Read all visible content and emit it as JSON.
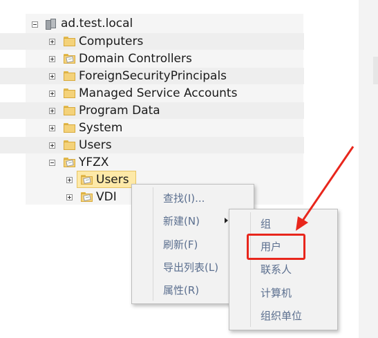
{
  "tree": {
    "root_label": "ad.test.local",
    "items": [
      {
        "label": "Computers",
        "icon": "folder-icon"
      },
      {
        "label": "Domain Controllers",
        "icon": "ou-folder-icon"
      },
      {
        "label": "ForeignSecurityPrincipals",
        "icon": "folder-icon"
      },
      {
        "label": "Managed Service Accounts",
        "icon": "folder-icon"
      },
      {
        "label": "Program Data",
        "icon": "folder-icon"
      },
      {
        "label": "System",
        "icon": "folder-icon"
      },
      {
        "label": "Users",
        "icon": "folder-icon"
      },
      {
        "label": "YFZX",
        "icon": "ou-folder-icon",
        "expanded": true
      }
    ],
    "children": [
      {
        "label": "Users",
        "icon": "ou-folder-icon",
        "selected": true
      },
      {
        "label": "VDI",
        "icon": "ou-folder-icon"
      }
    ]
  },
  "context_menu": {
    "items": [
      {
        "label": "查找(I)..."
      },
      {
        "label": "新建(N)",
        "has_submenu": true
      },
      {
        "label": "刷新(F)"
      },
      {
        "label": "导出列表(L)"
      },
      {
        "label": "属性(R)"
      }
    ]
  },
  "submenu": {
    "items": [
      {
        "label": "组"
      },
      {
        "label": "用户",
        "highlighted": true
      },
      {
        "label": "联系人"
      },
      {
        "label": "计算机"
      },
      {
        "label": "组织单位"
      }
    ]
  },
  "colors": {
    "highlight_border": "#e8261c",
    "menu_text": "#5b6f8f",
    "selection_bg": "#fde9a8"
  }
}
